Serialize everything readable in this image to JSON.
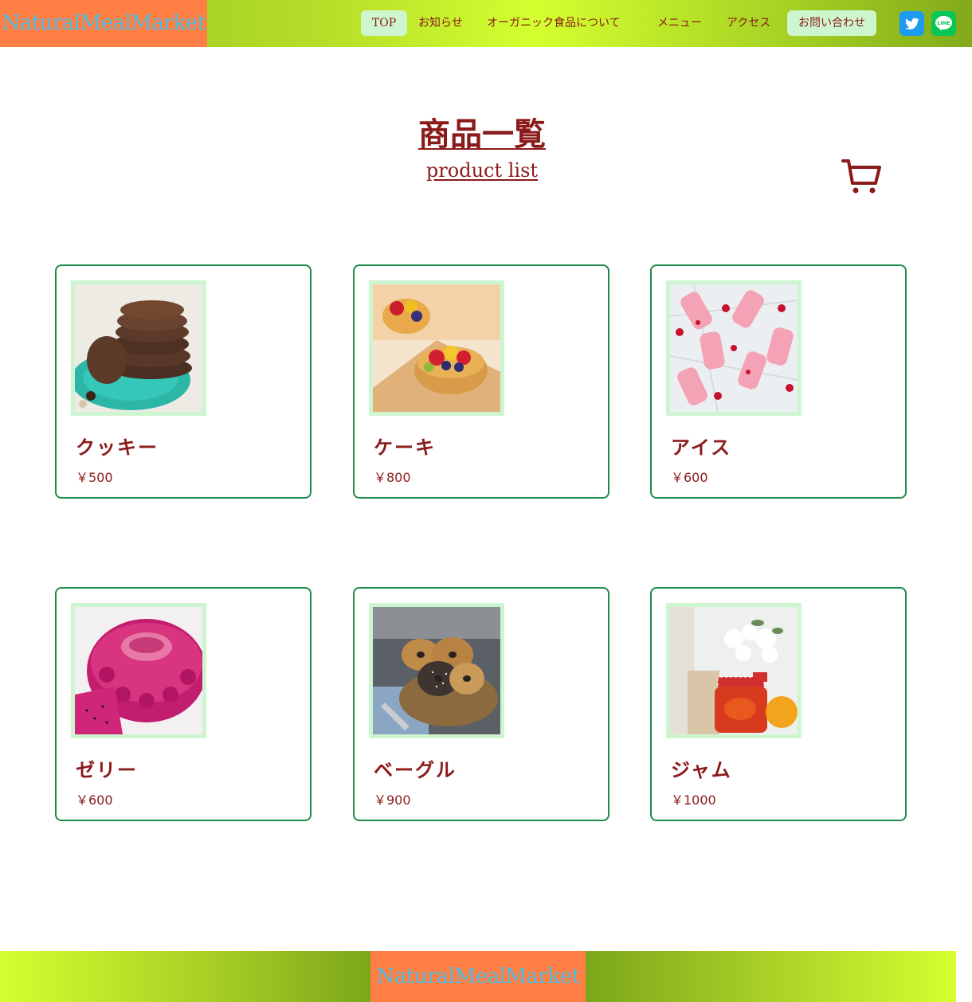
{
  "header": {
    "logo": "NaturalMealMarket",
    "nav": [
      {
        "label": "TOP"
      },
      {
        "label": "お知らせ"
      },
      {
        "label": "オーガニック食品について"
      },
      {
        "label": "メニュー"
      },
      {
        "label": "アクセス"
      },
      {
        "label": "お問い合わせ"
      }
    ],
    "social": [
      {
        "icon": "twitter-icon",
        "color": "#1d9bf0"
      },
      {
        "icon": "line-icon",
        "color": "#06c755",
        "text": "LINE"
      }
    ]
  },
  "page": {
    "title": "商品一覧",
    "subtitle": "product list",
    "cart_icon": "shopping-cart-icon"
  },
  "products": [
    {
      "name": "クッキー",
      "price": "￥500"
    },
    {
      "name": "ケーキ",
      "price": "￥800"
    },
    {
      "name": "アイス",
      "price": "￥600"
    },
    {
      "name": "ゼリー",
      "price": "￥600"
    },
    {
      "name": "ベーグル",
      "price": "￥900"
    },
    {
      "name": "ジャム",
      "price": "￥1000"
    }
  ],
  "footer": {
    "logo": "NaturalMealMarket"
  },
  "colors": {
    "accent_text": "#8b1a1a",
    "logo_bg": "#ff7f45",
    "logo_text": "#4bbbe0",
    "card_border": "#1e8c4a",
    "pill_bg": "#cdf6ce"
  }
}
